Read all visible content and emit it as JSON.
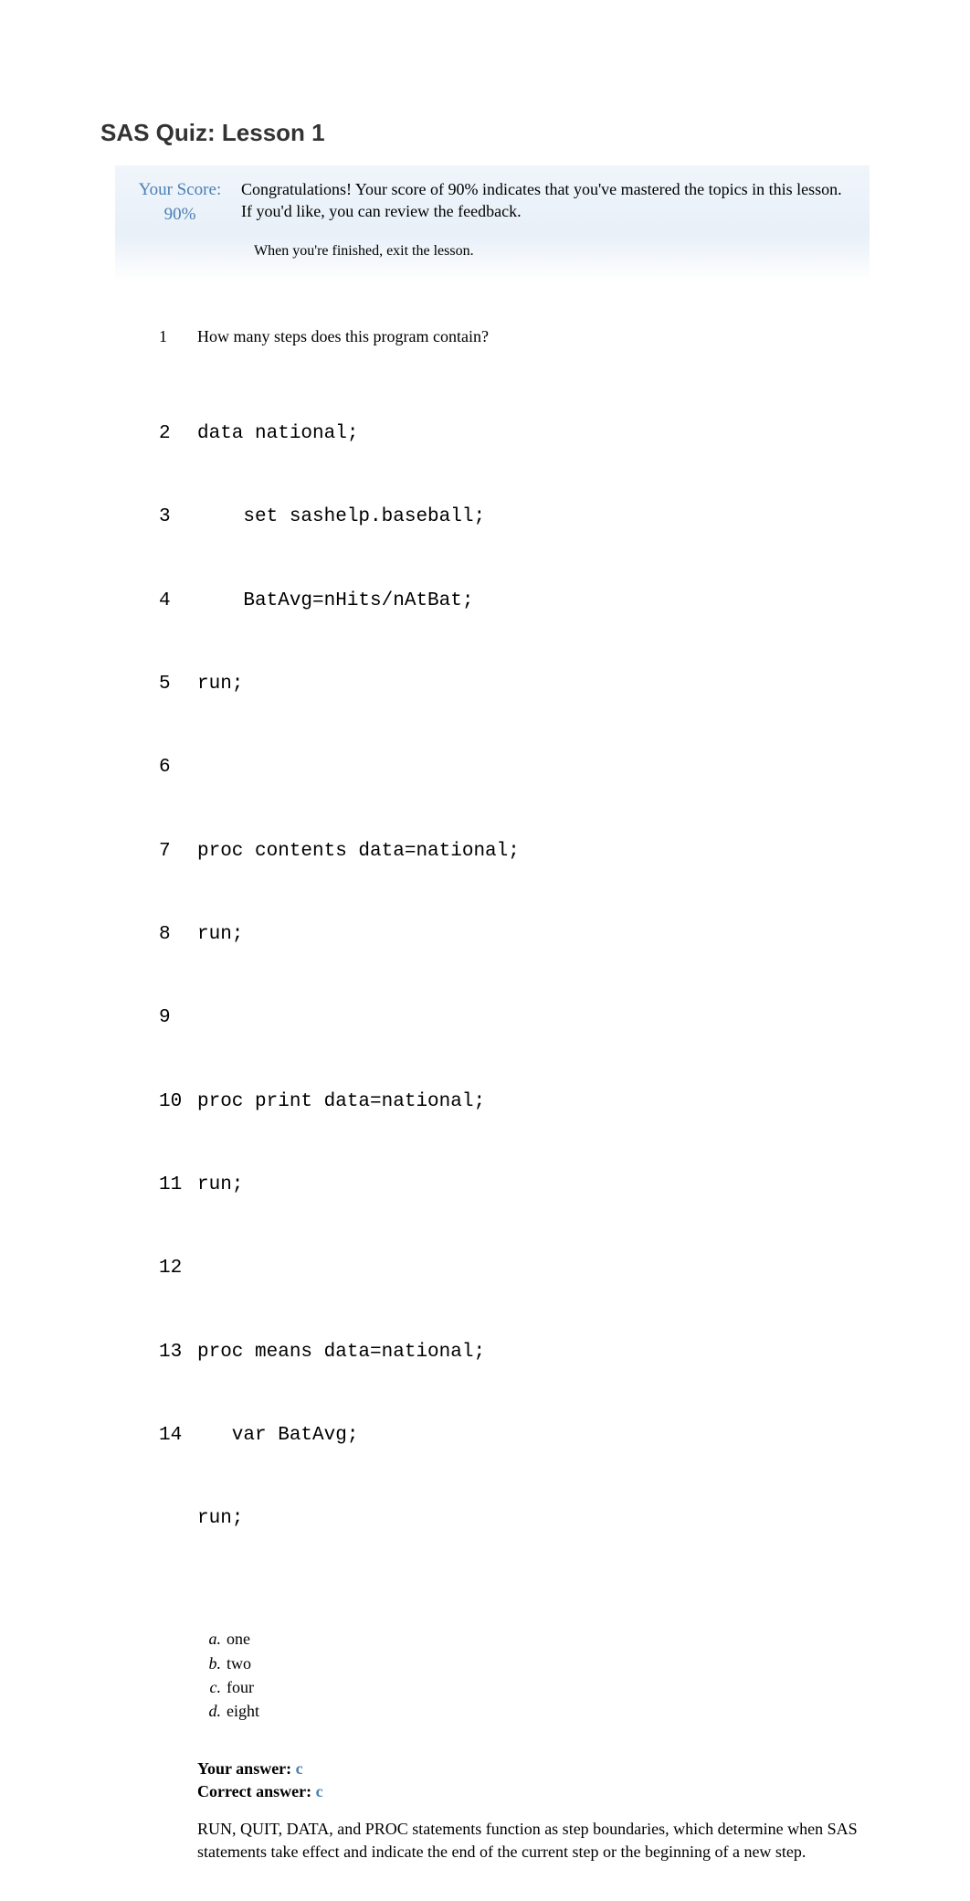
{
  "heading": "SAS Quiz: Lesson 1",
  "score": {
    "label": "Your Score:",
    "percent": "90%",
    "message": "Congratulations! Your score of 90% indicates that you've mastered the topics in this lesson. If you'd like, you can review the feedback.",
    "finish_note": "When you're finished, exit the lesson."
  },
  "question": {
    "number": "1",
    "text": "How many steps does this program contain?",
    "code_lines": [
      {
        "ln": "2",
        "code": "data national;"
      },
      {
        "ln": "3",
        "code": "    set sashelp.baseball;"
      },
      {
        "ln": "4",
        "code": "    BatAvg=nHits/nAtBat;"
      },
      {
        "ln": "5",
        "code": "run;"
      },
      {
        "ln": "6",
        "code": ""
      },
      {
        "ln": "7",
        "code": "proc contents data=national;"
      },
      {
        "ln": "8",
        "code": "run;"
      },
      {
        "ln": "9",
        "code": ""
      },
      {
        "ln": "10",
        "code": "proc print data=national;"
      },
      {
        "ln": "11",
        "code": "run;"
      },
      {
        "ln": "12",
        "code": ""
      },
      {
        "ln": "13",
        "code": "proc means data=national;"
      },
      {
        "ln": "14",
        "code": "   var BatAvg;"
      },
      {
        "ln": "",
        "code": "run;"
      }
    ],
    "options": [
      {
        "letter": "a.",
        "text": "one"
      },
      {
        "letter": "b.",
        "text": "two"
      },
      {
        "letter": "c.",
        "text": "four"
      },
      {
        "letter": "d.",
        "text": "eight"
      }
    ],
    "your_answer_label": "Your answer: ",
    "your_answer": "c",
    "correct_answer_label": "Correct answer: ",
    "correct_answer": "c",
    "explanation": "RUN, QUIT, DATA, and PROC statements function as step boundaries, which determine when SAS statements take effect and indicate the end of the current step or the beginning of a new step."
  }
}
